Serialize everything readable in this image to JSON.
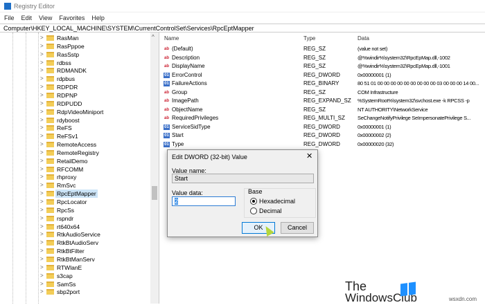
{
  "window": {
    "title": "Registry Editor"
  },
  "menu": [
    "File",
    "Edit",
    "View",
    "Favorites",
    "Help"
  ],
  "address": "Computer\\HKEY_LOCAL_MACHINE\\SYSTEM\\CurrentControlSet\\Services\\RpcEptMapper",
  "tree": [
    "RasMan",
    "RasPppoe",
    "RasSstp",
    "rdbss",
    "RDMANDK",
    "rdpbus",
    "RDPDR",
    "RDPNP",
    "RDPUDD",
    "RdpVideoMiniport",
    "rdyboost",
    "ReFS",
    "ReFSv1",
    "RemoteAccess",
    "RemoteRegistry",
    "RetailDemo",
    "RFCOMM",
    "rhproxy",
    "RmSvc",
    "RpcEptMapper",
    "RpcLocator",
    "RpcSs",
    "rspndr",
    "rt640x64",
    "RtkAudioService",
    "RtkBtAudioServ",
    "RtkBtFilter",
    "RtkBtManServ",
    "RTWlanE",
    "s3cap",
    "SamSs",
    "sbp2port"
  ],
  "tree_selected": "RpcEptMapper",
  "columns": {
    "name": "Name",
    "type": "Type",
    "data": "Data"
  },
  "values": [
    {
      "icon": "string",
      "name": "(Default)",
      "type": "REG_SZ",
      "data": "(value not set)"
    },
    {
      "icon": "string",
      "name": "Description",
      "type": "REG_SZ",
      "data": "@%windir%\\system32\\RpcEpMap.dll,-1002"
    },
    {
      "icon": "string",
      "name": "DisplayName",
      "type": "REG_SZ",
      "data": "@%windir%\\system32\\RpcEpMap.dll,-1001"
    },
    {
      "icon": "binary",
      "name": "ErrorControl",
      "type": "REG_DWORD",
      "data": "0x00000001 (1)"
    },
    {
      "icon": "binary",
      "name": "FailureActions",
      "type": "REG_BINARY",
      "data": "80 51 01 00 00 00 00 00 00 00 00 00 03 00 00 00 14 00..."
    },
    {
      "icon": "string",
      "name": "Group",
      "type": "REG_SZ",
      "data": "COM Infrastructure"
    },
    {
      "icon": "string",
      "name": "ImagePath",
      "type": "REG_EXPAND_SZ",
      "data": "%SystemRoot%\\system32\\svchost.exe -k RPCSS -p"
    },
    {
      "icon": "string",
      "name": "ObjectName",
      "type": "REG_SZ",
      "data": "NT AUTHORITY\\NetworkService"
    },
    {
      "icon": "string",
      "name": "RequiredPrivileges",
      "type": "REG_MULTI_SZ",
      "data": "SeChangeNotifyPrivilege SeImpersonatePrivilege S..."
    },
    {
      "icon": "binary",
      "name": "ServiceSidType",
      "type": "REG_DWORD",
      "data": "0x00000001 (1)"
    },
    {
      "icon": "binary",
      "name": "Start",
      "type": "REG_DWORD",
      "data": "0x00000002 (2)"
    },
    {
      "icon": "binary",
      "name": "Type",
      "type": "REG_DWORD",
      "data": "0x00000020 (32)"
    }
  ],
  "dialog": {
    "title": "Edit DWORD (32-bit) Value",
    "close": "✕",
    "value_name_label": "Value name:",
    "value_name": "Start",
    "value_data_label": "Value data:",
    "value_data": "2",
    "base_label": "Base",
    "hex": "Hexadecimal",
    "dec": "Decimal",
    "ok": "OK",
    "cancel": "Cancel"
  },
  "watermark": {
    "line1": "The",
    "line2": "WindowsClub"
  },
  "site": "wsxdn.com"
}
